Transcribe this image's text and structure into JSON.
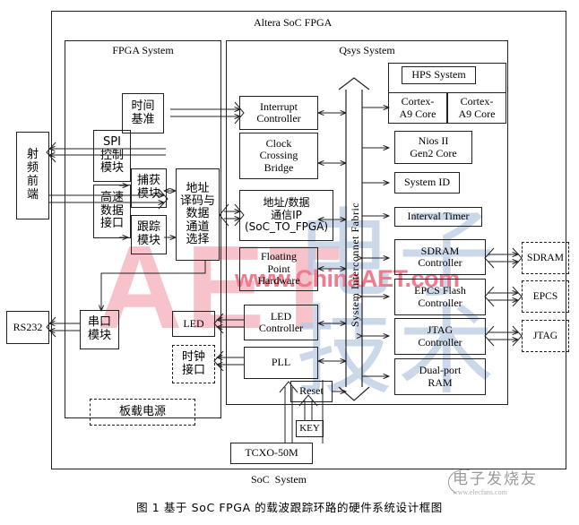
{
  "figure": {
    "caption": "图 1  基于 SoC FPGA 的载波跟踪环路的硬件系统设计框图",
    "outer_label": "SoC  System",
    "chip_label": "Altera SoC FPGA"
  },
  "watermarks": {
    "aet": "AET",
    "china_aet": "www.ChinaAET.com",
    "calligraphy": "电子技术",
    "logo": "电子发烧友",
    "logo_sub": "www.elecfans.com"
  },
  "containers": {
    "fpga_system": "FPGA System",
    "qsys_system": "Qsys System"
  },
  "external_blocks": [
    {
      "name": "rf-front-end",
      "label": "射\n频\n前\n端"
    },
    {
      "name": "rs232",
      "label": "RS232"
    },
    {
      "name": "sdram",
      "label": "SDRAM"
    },
    {
      "name": "epcs",
      "label": "EPCS"
    },
    {
      "name": "jtag",
      "label": "JTAG"
    },
    {
      "name": "tcxo",
      "label": "TCXO-50M"
    },
    {
      "name": "key",
      "label": "KEY"
    },
    {
      "name": "board-power",
      "label": "板载电源"
    }
  ],
  "fpga_blocks": [
    {
      "name": "time-reference",
      "label": "时间\n基准"
    },
    {
      "name": "spi-control-module",
      "label": "SPI\n控制\n模块"
    },
    {
      "name": "high-speed-data-interface",
      "label": "高速\n数据\n接口"
    },
    {
      "name": "acquisition-module",
      "label": "捕获\n模块"
    },
    {
      "name": "tracking-module",
      "label": "跟踪\n模块"
    },
    {
      "name": "address-decode-channel-select",
      "label": "地址\n译码与\n数据\n通道\n选择"
    },
    {
      "name": "serial-port-module",
      "label": "串口\n模块"
    },
    {
      "name": "led",
      "label": "LED"
    },
    {
      "name": "clock-interface",
      "label": "时钟\n接口"
    }
  ],
  "qsys_blocks": [
    {
      "name": "interrupt-controller",
      "label": "Interrupt\nController"
    },
    {
      "name": "clock-crossing-bridge",
      "label": "Clock\nCrossing\nBridge"
    },
    {
      "name": "address-data-comm-ip",
      "label": "地址/数据\n通信IP\n(SoC_TO_FPGA)"
    },
    {
      "name": "floating-point-hardware",
      "label": "Floating\nPoint\nHardware"
    },
    {
      "name": "led-controller",
      "label": "LED\nController"
    },
    {
      "name": "pll",
      "label": "PLL"
    },
    {
      "name": "reset",
      "label": "Reset"
    },
    {
      "name": "hps-system",
      "label": "HPS System"
    },
    {
      "name": "cortex-a9-core-0",
      "label": "Cortex-\nA9 Core"
    },
    {
      "name": "cortex-a9-core-1",
      "label": "Cortex-\nA9 Core"
    },
    {
      "name": "nios-ii-gen2-core",
      "label": "Nios II\nGen2 Core"
    },
    {
      "name": "system-id",
      "label": "System ID"
    },
    {
      "name": "interval-timer",
      "label": "Interval Timer"
    },
    {
      "name": "sdram-controller",
      "label": "SDRAM\nController"
    },
    {
      "name": "epcs-flash-controller",
      "label": "EPCS Flash\nController"
    },
    {
      "name": "jtag-controller",
      "label": "JTAG\nController"
    },
    {
      "name": "dual-port-ram",
      "label": "Dual-port\nRAM"
    }
  ],
  "bus": {
    "label": "System Interconnet Fabric"
  }
}
